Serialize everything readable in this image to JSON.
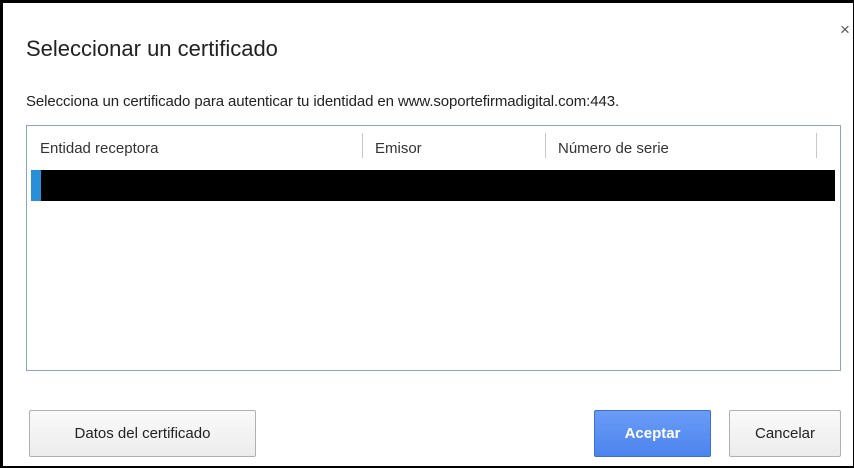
{
  "dialog": {
    "title": "Seleccionar un certificado",
    "close_label": "×",
    "description": "Selecciona un certificado para autenticar tu identidad en www.soportefirmadigital.com:443."
  },
  "table": {
    "columns": [
      "Entidad receptora",
      "Emisor",
      "Número de serie"
    ],
    "rows_selected_count": 1,
    "selected_row_color": "#000000",
    "selection_accent": "#2a8fd9"
  },
  "buttons": {
    "details": "Datos del certificado",
    "accept": "Aceptar",
    "cancel": "Cancelar"
  },
  "colors": {
    "accept_button": "#4c84ee",
    "table_border": "#8aa6c4"
  },
  "icons": {
    "close": "close-icon"
  }
}
